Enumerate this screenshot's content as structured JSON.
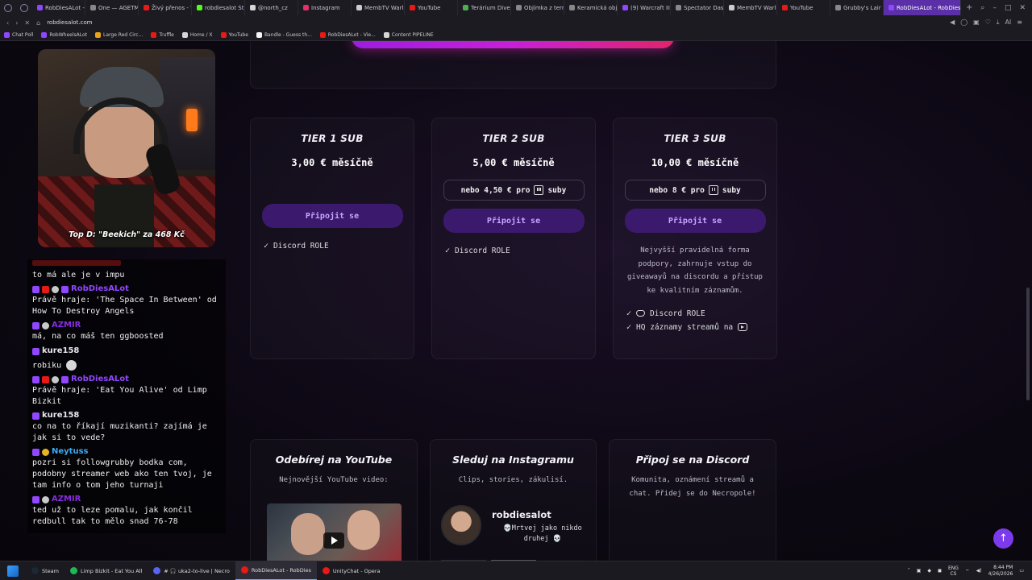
{
  "browser": {
    "tabs": [
      {
        "label": "RobDiesALot -",
        "color": "#9146ff"
      },
      {
        "label": "One — AGETM",
        "color": "#888888"
      },
      {
        "label": "Živý přenos - Y",
        "color": "#e91916"
      },
      {
        "label": "robdiesalot Stre",
        "color": "#53fc18"
      },
      {
        "label": "@north_cz",
        "color": "#d6d6d6"
      },
      {
        "label": "Instagram",
        "color": "#e1306c"
      },
      {
        "label": "MembTV Warlo",
        "color": "#cccccc"
      },
      {
        "label": "YouTube",
        "color": "#e91916"
      },
      {
        "label": "Terárium Dive",
        "color": "#4caf50"
      },
      {
        "label": "Objímka z term",
        "color": "#888888"
      },
      {
        "label": "Keramická obje",
        "color": "#888888"
      },
      {
        "label": "(9) Warcraft III",
        "color": "#9146ff"
      },
      {
        "label": "Spectator Dash",
        "color": "#888888"
      },
      {
        "label": "MembTV Warlo",
        "color": "#cccccc"
      },
      {
        "label": "YouTube",
        "color": "#e91916"
      },
      {
        "label": "Grubby's Lair",
        "color": "#888888"
      },
      {
        "label": "RobDiesALot - RobDiesAl",
        "color": "#9146ff",
        "active": true
      }
    ],
    "url": "robdiesalot.com",
    "bookmarks": [
      {
        "label": "Chat Poll",
        "color": "#9146ff"
      },
      {
        "label": "RobWheelsALot",
        "color": "#9146ff"
      },
      {
        "label": "Large Red Circ...",
        "color": "#e8a317"
      },
      {
        "label": "Truffle",
        "color": "#e91916"
      },
      {
        "label": "Home / X",
        "color": "#d6d6d6"
      },
      {
        "label": "YouTube",
        "color": "#e91916"
      },
      {
        "label": "Bandle - Guess th...",
        "color": "#f5f5f5"
      },
      {
        "label": "RobDiesALot - Vie...",
        "color": "#e91916"
      },
      {
        "label": "Content PIPELINE",
        "color": "#d6d6d6"
      }
    ],
    "right_icon_ai": "AI"
  },
  "tiers": [
    {
      "name": "TIER 1 SUB",
      "price": "3,00 € měsíčně",
      "join": "Připojit se",
      "features": [
        {
          "label": "Discord ROLE"
        }
      ]
    },
    {
      "name": "TIER 2 SUB",
      "price": "5,00 € měsíčně",
      "alt_price_pre": "nebo 4,50 € pro",
      "alt_price_post": "suby",
      "join": "Připojit se",
      "features": [
        {
          "label": "Discord ROLE"
        }
      ]
    },
    {
      "name": "TIER 3 SUB",
      "price": "10,00 € měsíčně",
      "alt_price_pre": "nebo 8 € pro",
      "alt_price_post": "suby",
      "join": "Připojit se",
      "description": "Nejvyšší pravidelná forma podpory, zahrnuje vstup do giveawayů na discordu a přístup ke kvalitním záznamům.",
      "features": [
        {
          "label": "Discord ROLE"
        },
        {
          "label": "HQ záznamy streamů na"
        }
      ]
    }
  ],
  "socials": {
    "youtube": {
      "title": "Odebírej na YouTube",
      "subtitle": "Nejnovější YouTube video:"
    },
    "instagram": {
      "title": "Sleduj na Instagramu",
      "subtitle": "Clips, stories, zákulisí.",
      "handle": "robdiesalot",
      "bio": "💀Mrtvej jako nikdo druhej 💀"
    },
    "discord": {
      "title": "Připoj se na Discord",
      "subtitle": "Komunita, oznámení streamů a chat. Přidej se do Necropole!"
    }
  },
  "webcam": {
    "caption": "Top D: \"Beekich\" za 468 Kč"
  },
  "chat": {
    "messages": [
      {
        "user": "",
        "text": "to má ale je v impu"
      },
      {
        "user": "RobDiesALot",
        "user_color": "#9146ff",
        "text": "Právě hraje: 'The Space In Between' od How To Destroy Angels"
      },
      {
        "user": "AZMIR",
        "user_color": "#8a2be2",
        "text": "má, na co máš ten ggboosted"
      },
      {
        "user": "kure158",
        "user_color": "#e8e6ef",
        "text": "robiku"
      },
      {
        "user": "RobDiesALot",
        "user_color": "#9146ff",
        "text": "Právě hraje: 'Eat You Alive' od Limp Bizkit"
      },
      {
        "user": "kure158",
        "user_color": "#e8e6ef",
        "text": "co na to říkají muzikanti? zajímá je jak si to vede?"
      },
      {
        "user": "Neytuss",
        "user_color": "#3fa9f5",
        "text": "pozri si followgrubby bodka com, podobny streamer web ako ten tvoj, je tam info o tom jeho turnaji"
      },
      {
        "user": "AZMIR",
        "user_color": "#8a2be2",
        "text": "ted už to leze pomalu, jak končil redbull tak to mělo snad 76-78"
      }
    ]
  },
  "taskbar": {
    "items": [
      {
        "label": "Steam",
        "color": "#1b2838"
      },
      {
        "label": "Limp Bizkit - Eat You All",
        "color": "#1db954"
      },
      {
        "label": "# 🎧 uka2-to-live | Necro",
        "color": "#5865f2"
      },
      {
        "label": "RobDiesALot - RobDies",
        "color": "#e91916",
        "active": true
      },
      {
        "label": "UnityChat - Opera",
        "color": "#e91916"
      }
    ],
    "lang_top": "ENG",
    "lang_bottom": "CS",
    "time": "8:44 PM",
    "date": "4/26/2026"
  },
  "colors": {
    "accent": "#7c3aed",
    "join_bg": "#3b1a6e",
    "join_text": "#c9a4ff"
  },
  "icons": {
    "scroll_top": "↑",
    "check": "✓"
  }
}
